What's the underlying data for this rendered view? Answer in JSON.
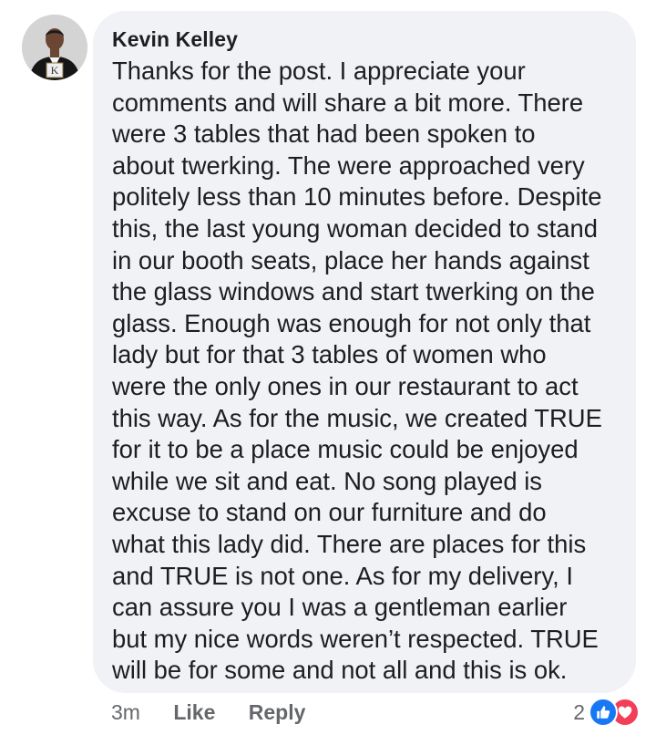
{
  "comment": {
    "author": "Kevin Kelley",
    "avatar_icon": "profile-photo-man-in-suit-icon",
    "avatar_monogram": "K",
    "text_lines": [
      "Thanks for the post. I appreciate your",
      "comments and will share a bit more. There",
      "were 3 tables that had been spoken to",
      "about twerking. The were approached very",
      "politely less than 10 minutes before. Despite",
      "this, the last young woman decided to stand",
      "in our booth seats, place her hands against",
      "the glass windows and start twerking on the",
      "glass. Enough was enough for not only that",
      "lady but for that 3 tables of women who",
      "were the only ones in our restaurant to act",
      "this way. As for the music, we created TRUE",
      "for it to be a place music could be enjoyed",
      "while we sit and eat. No song played is",
      "excuse to stand on our furniture and do",
      "what this lady did. There are places for this",
      "and TRUE is not one. As for my delivery, I",
      "can assure you I was a gentleman earlier",
      "but my nice words weren’t respected. TRUE",
      "will be for some and not all and this is ok."
    ]
  },
  "footer": {
    "time": "3m",
    "like_label": "Like",
    "reply_label": "Reply",
    "reaction_count": "2",
    "reaction_icons": [
      "like-icon",
      "love-icon"
    ]
  },
  "colors": {
    "bubble": "#f0f2f5",
    "text": "#1c1e21",
    "meta": "#65676b",
    "like": "#1877f2",
    "love": "#f33e58"
  }
}
